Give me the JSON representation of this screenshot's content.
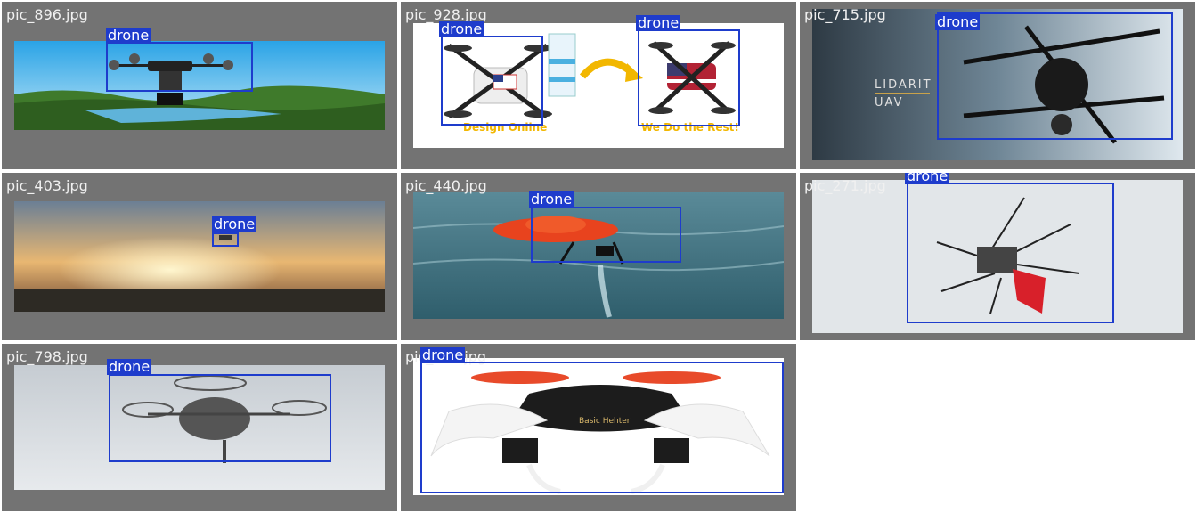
{
  "label": "drone",
  "box_color": "#1e3ccc",
  "tile_bg": "#737373",
  "tiles": [
    {
      "filename": "pic_896.jpg"
    },
    {
      "filename": "pic_928.jpg",
      "captions": [
        "Design Online",
        "We Do the Rest!"
      ]
    },
    {
      "filename": "pic_715.jpg",
      "brand_line1": "LIDARIT",
      "brand_line2": "UAV"
    },
    {
      "filename": "pic_403.jpg"
    },
    {
      "filename": "pic_440.jpg"
    },
    {
      "filename": "pic_271.jpg"
    },
    {
      "filename": "pic_798.jpg"
    },
    {
      "filename": "pic_1x1.jpg",
      "product_text": "Basic Hehter"
    }
  ]
}
